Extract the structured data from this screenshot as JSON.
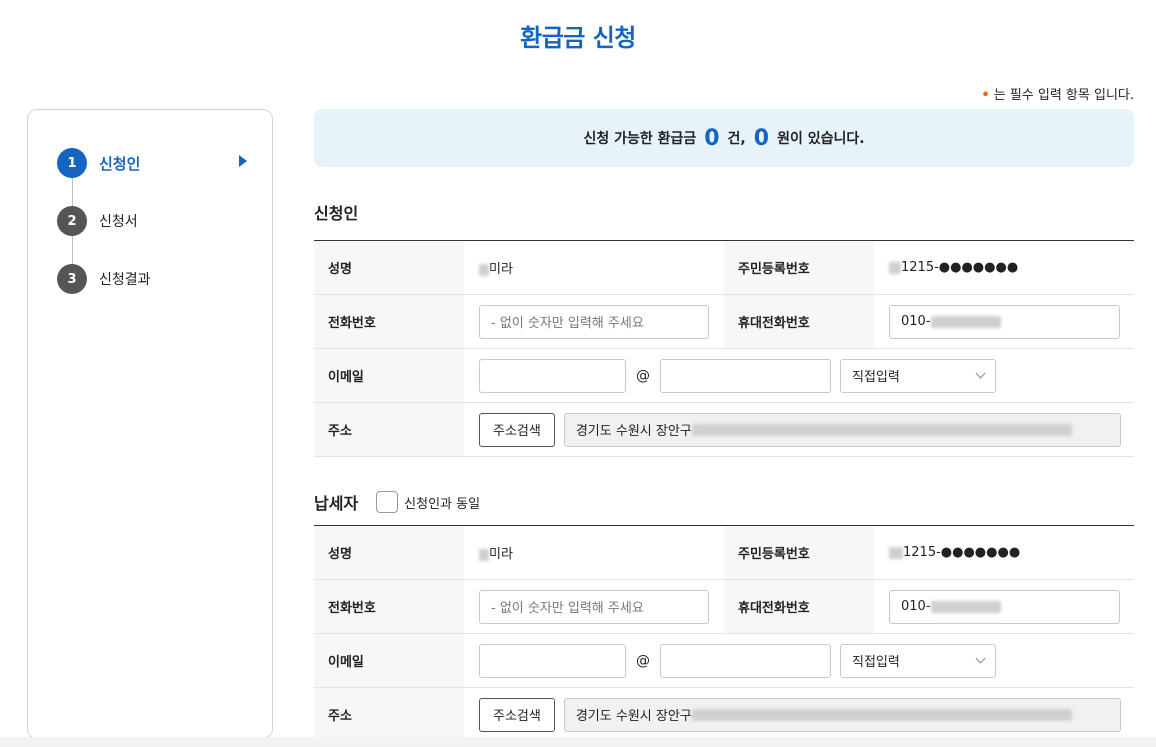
{
  "page": {
    "title": "환급금 신청",
    "required_note": "는 필수 입력 항목 입니다."
  },
  "steps": [
    {
      "num": "1",
      "label": "신청인"
    },
    {
      "num": "2",
      "label": "신청서"
    },
    {
      "num": "3",
      "label": "신청결과"
    }
  ],
  "banner": {
    "prefix": "신청 가능한 환급금",
    "count": "0",
    "count_unit": "건,",
    "amount": "0",
    "suffix": "원이 있습니다."
  },
  "applicant": {
    "section_title": "신청인",
    "labels": {
      "name": "성명",
      "rrn": "주민등록번호",
      "phone": "전화번호",
      "mobile": "휴대전화번호",
      "email": "이메일",
      "address": "주소"
    },
    "name_value": "미라",
    "rrn_value": "1215-●●●●●●●",
    "phone_placeholder": "- 없이 숫자만 입력해 주세요",
    "mobile_value": "010-",
    "email_at": "@",
    "email_domain_select": "직접입력",
    "address_button": "주소검색",
    "address_value": "경기도 수원시 장안구"
  },
  "taxpayer": {
    "section_title": "납세자",
    "same_as_label": "신청인과 동일",
    "labels": {
      "name": "성명",
      "rrn": "주민등록번호",
      "phone": "전화번호",
      "mobile": "휴대전화번호",
      "email": "이메일",
      "address": "주소"
    },
    "name_value": "미라",
    "rrn_value": "1215-●●●●●●●",
    "phone_placeholder": "- 없이 숫자만 입력해 주세요",
    "mobile_value": "010-",
    "email_at": "@",
    "email_domain_select": "직접입력",
    "address_button": "주소검색",
    "address_value": "경기도 수원시 장안구"
  },
  "colors": {
    "accent": "#1565c0",
    "banner_bg": "#e6f3fb",
    "required_dot": "#e56b1f"
  }
}
